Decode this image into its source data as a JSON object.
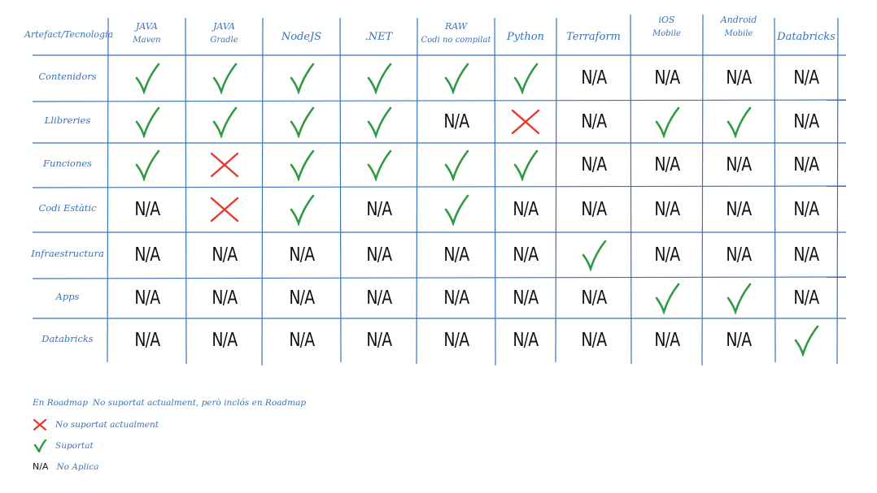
{
  "header_corner": "Artefact/Tecnologia",
  "columns": [
    {
      "l1": "JAVA",
      "l2": "Maven"
    },
    {
      "l1": "JAVA",
      "l2": "Gradle"
    },
    {
      "l1": "NodeJS",
      "l2": ""
    },
    {
      "l1": ".NET",
      "l2": ""
    },
    {
      "l1": "RAW",
      "l2": "Codi no compilat"
    },
    {
      "l1": "Python",
      "l2": ""
    },
    {
      "l1": "Terraform",
      "l2": ""
    },
    {
      "l1": "iOS",
      "l2": "Mobile"
    },
    {
      "l1": "Android",
      "l2": "Mobile"
    },
    {
      "l1": "Databricks",
      "l2": ""
    }
  ],
  "rows": [
    {
      "label": "Contenidors",
      "cells": [
        "check",
        "check",
        "check",
        "check",
        "check",
        "check",
        "N/A",
        "N/A",
        "N/A",
        "N/A"
      ]
    },
    {
      "label": "Llibreries",
      "cells": [
        "check",
        "check",
        "check",
        "check",
        "N/A",
        "cross",
        "N/A",
        "check",
        "check",
        "N/A"
      ]
    },
    {
      "label": "Funciones",
      "cells": [
        "check",
        "cross",
        "check",
        "check",
        "check",
        "check",
        "N/A",
        "N/A",
        "N/A",
        "N/A"
      ]
    },
    {
      "label": "Codi Estàtic",
      "cells": [
        "N/A",
        "cross",
        "check",
        "N/A",
        "check",
        "N/A",
        "N/A",
        "N/A",
        "N/A",
        "N/A"
      ]
    },
    {
      "label": "Infraestructura",
      "cells": [
        "N/A",
        "N/A",
        "N/A",
        "N/A",
        "N/A",
        "N/A",
        "check",
        "N/A",
        "N/A",
        "N/A"
      ]
    },
    {
      "label": "Apps",
      "cells": [
        "N/A",
        "N/A",
        "N/A",
        "N/A",
        "N/A",
        "N/A",
        "N/A",
        "check",
        "check",
        "N/A"
      ]
    },
    {
      "label": "Databricks",
      "cells": [
        "N/A",
        "N/A",
        "N/A",
        "N/A",
        "N/A",
        "N/A",
        "N/A",
        "N/A",
        "N/A",
        "check"
      ]
    }
  ],
  "legend": {
    "roadmap_key": "En Roadmap",
    "roadmap_text": "No suportat actualment, però inclós en Roadmap",
    "cross_text": "No suportat actualment",
    "check_text": "Suportat",
    "na_key": "N/A",
    "na_text": "No Aplica"
  },
  "colors": {
    "grid": "#3a73b8",
    "label": "#3a73b8",
    "check": "#2e9a43",
    "cross": "#e53b2f"
  }
}
